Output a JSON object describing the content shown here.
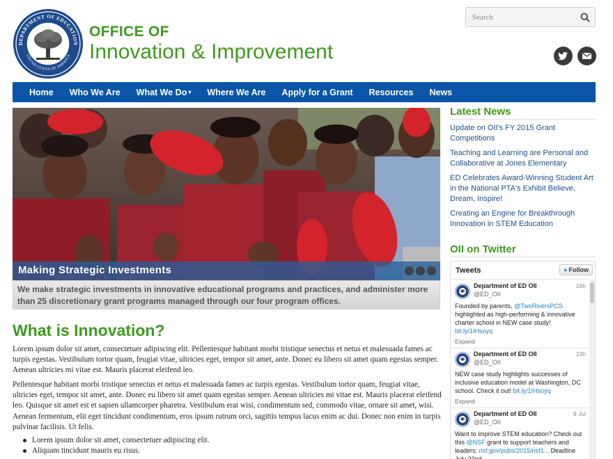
{
  "header": {
    "seal_outer_text": "DEPARTMENT OF EDUCATION",
    "seal_bottom_text": "UNITED STATES OF AMERICA",
    "office_line1": "OFFICE OF",
    "office_line2": "Innovation & Improvement",
    "search_placeholder": "Search"
  },
  "nav": {
    "items": [
      {
        "label": "Home"
      },
      {
        "label": "Who We Are"
      },
      {
        "label": "What We Do",
        "has_dropdown": true
      },
      {
        "label": "Where We Are"
      },
      {
        "label": "Apply for a Grant"
      },
      {
        "label": "Resources"
      },
      {
        "label": "News"
      }
    ],
    "caret": "▾"
  },
  "hero": {
    "caption_title": "Making Strategic Investments",
    "description": "We make strategic investments in innovative educational programs and practices, and administer more than 25 discretionary grant programs managed through our four program offices."
  },
  "main": {
    "heading": "What is Innovation?",
    "paragraph1": "Lorem ipsum dolor sit amet, consectetuer adipiscing elit. Pellentesque habitant morbi tristique senectus et netus et malesuada fames ac turpis egestas. Vestibulum tortor quam, feugiat vitae, ultricies eget, tempor sit amet, ante. Donec eu libero sit amet quam egestas semper. Aenean ultricies mi vitae est. Mauris placerat eleifend leo.",
    "paragraph2": "Pellentesque habitant morbi tristique senectus et netus et malesuada fames ac turpis egestas. Vestibulum tortor quam, feugiat vitae, ultricies eget, tempor sit amet, ante. Donec eu libero sit amet quam egestas semper. Aenean ultricies mi vitae est. Mauris placerat eleifend leo. Quisque sit amet est et sapien ullamcorper pharetra. Vestibulum erat wisi, condimentum sed, commodo vitae, ornare sit amet, wisi. Aenean fermentum, elit eget tincidunt condimentum, eros ipsum rutrum orci, sagittis tempus lacus enim ac dui. Donec non enim in turpis pulvinar facilisis. Ut felis.",
    "bullets": [
      "Lorem ipsum dolor sit amet, consectetuer adipiscing elit.",
      "Aliquam tincidunt mauris eu risus."
    ]
  },
  "sidebar": {
    "news_heading": "Latest News",
    "news_items": [
      "Update on OII's FY 2015 Grant Competitions",
      "Teaching and Learning are Personal and Collaborative at Jones Elementary",
      "ED Celebrates Award-Winning Student Art in the National PTA's Exhibit Believe, Dream, Inspire!",
      "Creating an Engine for Breakthrough Innovation in STEM Education"
    ],
    "twitter_heading": "OII on Twitter"
  },
  "twitter": {
    "title": "Tweets",
    "follow_label": "Follow",
    "expand_label": "Expand",
    "tweets": [
      {
        "name": "Department of ED OII",
        "handle": "@ED_OII",
        "time": "16h",
        "pre": "Founded by parents, ",
        "mention": "@TwoRiversPCS",
        "mid": " highlighted as high-performing & innovative charter school in NEW case study! ",
        "link": "bit.ly/1IHsoyq",
        "post": ""
      },
      {
        "name": "Department of ED OII",
        "handle": "@ED_OII",
        "time": "23h",
        "pre": "NEW case study highlights successes of inclusive education model at Washington, DC school. Check it out! ",
        "mention": "",
        "mid": "",
        "link": "bit.ly/1IHsoyq",
        "post": ""
      },
      {
        "name": "Department of ED OII",
        "handle": "@ED_OII",
        "time": "8 Jul",
        "pre": "Want to improve STEM education? Check out this ",
        "mention": "@NSF",
        "mid": " grant to support teachers and leaders: ",
        "link": "nsf.gov/pubs/2015/nsf1...",
        "post": " Deadline July 22nd"
      }
    ]
  },
  "colors": {
    "brand_green": "#3d9b1d",
    "nav_blue": "#0a55a8",
    "link_blue": "#1a4f8f",
    "twitter_link": "#1d7ed0"
  },
  "icons": {
    "search": "search-icon",
    "twitter": "twitter-icon",
    "mail": "mail-icon"
  }
}
